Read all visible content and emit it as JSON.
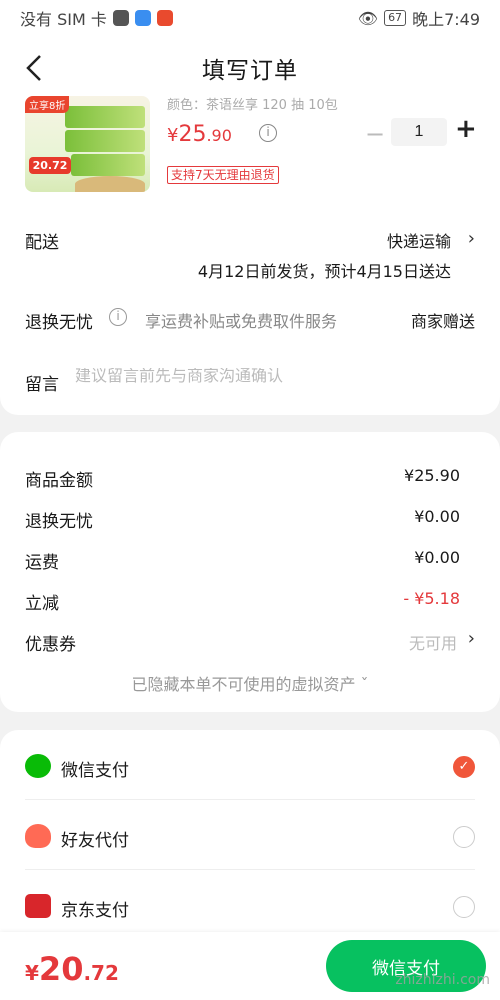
{
  "status_bar": {
    "carrier": "没有 SIM 卡",
    "battery": "67",
    "time": "晚上7:49"
  },
  "nav": {
    "title": "填写订单"
  },
  "product": {
    "spec": "颜色：茶语丝享 120 抽 10包",
    "image_badge_top": "立享8折",
    "image_badge_price": "20.72",
    "price_symbol": "¥",
    "price_int": "25",
    "price_dec": ".90",
    "quantity": "1",
    "return_tag": "支持7天无理由退货"
  },
  "shipping": {
    "label": "配送",
    "method": "快递运输",
    "date": "4月12日前发货，预计4月15日送达"
  },
  "exchange": {
    "label": "退换无忧",
    "desc": "享运费补贴或免费取件服务",
    "gift": "商家赠送"
  },
  "note": {
    "label": "留言",
    "placeholder": "建议留言前先与商家沟通确认"
  },
  "amounts": [
    {
      "label": "商品金额",
      "value": "¥25.90",
      "red": false
    },
    {
      "label": "退换无忧",
      "value": "¥0.00",
      "red": false
    },
    {
      "label": "运费",
      "value": "¥0.00",
      "red": false
    },
    {
      "label": "立减",
      "value": "- ¥5.18",
      "red": true
    }
  ],
  "coupon": {
    "label": "优惠券",
    "value": "无可用"
  },
  "hidden_note": "已隐藏本单不可使用的虚拟资产 ˇ",
  "payments": [
    {
      "label": "微信支付",
      "checked": true
    },
    {
      "label": "好友代付",
      "checked": false
    },
    {
      "label": "京东支付",
      "checked": false
    }
  ],
  "total": {
    "symbol": "¥",
    "int": "20",
    "dec": ".72"
  },
  "pay_button": "微信支付",
  "watermark": "zhizhizhi.com"
}
